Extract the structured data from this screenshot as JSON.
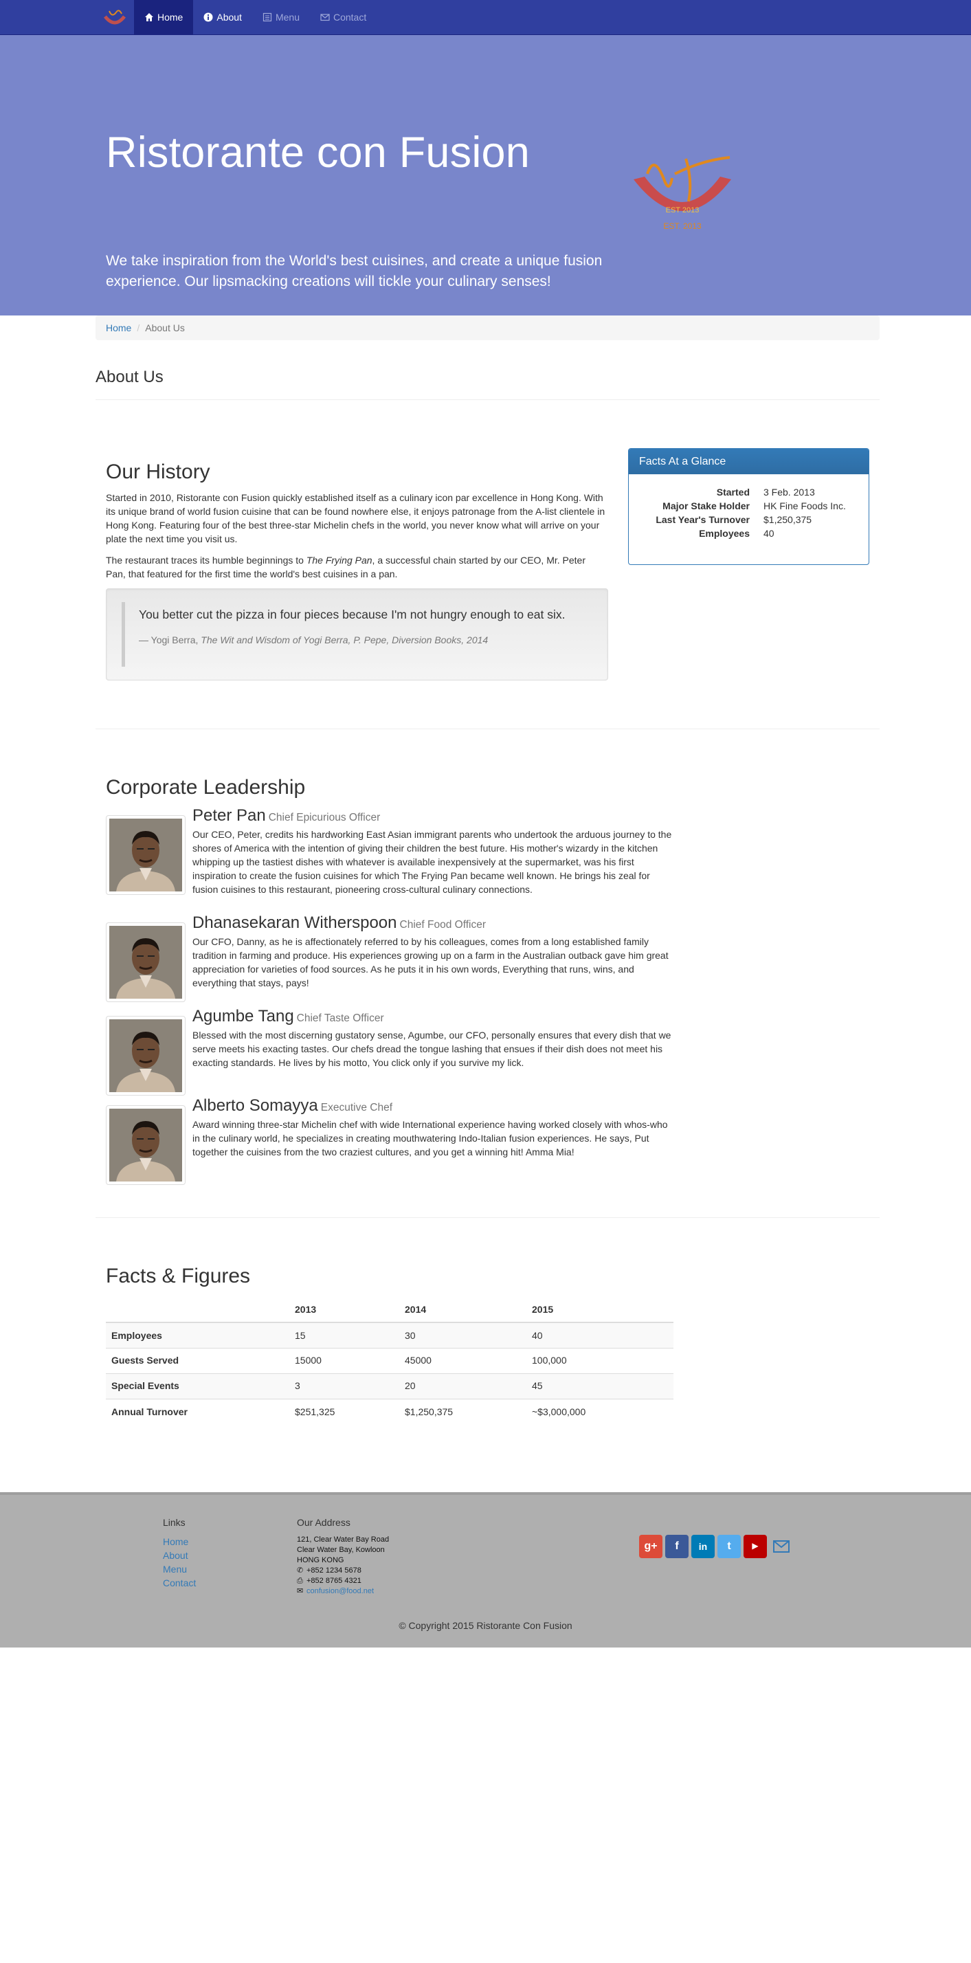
{
  "nav": {
    "brand_alt": "Ristorante con Fusion logo",
    "items": [
      {
        "label": "Home",
        "icon": "home-icon",
        "active": true
      },
      {
        "label": "About",
        "icon": "info-icon",
        "active": false
      },
      {
        "label": "Menu",
        "icon": "list-icon",
        "active": false
      },
      {
        "label": "Contact",
        "icon": "envelope-icon",
        "active": false
      }
    ]
  },
  "hero": {
    "title": "Ristorante con Fusion",
    "tagline": "We take inspiration from the World's best cuisines, and create a unique fusion experience. Our lipsmacking creations will tickle your culinary senses!"
  },
  "breadcrumb": {
    "home": "Home",
    "current": "About Us"
  },
  "page_title": "About Us",
  "history": {
    "heading": "Our History",
    "p1": "Started in 2010, Ristorante con Fusion quickly established itself as a culinary icon par excellence in Hong Kong. With its unique brand of world fusion cuisine that can be found nowhere else, it enjoys patronage from the A-list clientele in Hong Kong. Featuring four of the best three-star Michelin chefs in the world, you never know what will arrive on your plate the next time you visit us.",
    "p2_before": "The restaurant traces its humble beginnings to ",
    "p2_em": "The Frying Pan",
    "p2_after": ", a successful chain started by our CEO, Mr. Peter Pan, that featured for the first time the world's best cuisines in a pan.",
    "quote": "You better cut the pizza in four pieces because I'm not hungry enough to eat six.",
    "quote_author": "— Yogi Berra, ",
    "quote_source": "The Wit and Wisdom of Yogi Berra, P. Pepe, Diversion Books, 2014"
  },
  "facts": {
    "heading": "Facts At a Glance",
    "rows": [
      {
        "k": "Started",
        "v": "3 Feb. 2013"
      },
      {
        "k": "Major Stake Holder",
        "v": "HK Fine Foods Inc."
      },
      {
        "k": "Last Year's Turnover",
        "v": "$1,250,375"
      },
      {
        "k": "Employees",
        "v": "40"
      }
    ]
  },
  "leadership": {
    "heading": "Corporate Leadership",
    "leaders": [
      {
        "name": "Peter Pan",
        "title": "Chief Epicurious Officer",
        "desc": "Our CEO, Peter, credits his hardworking East Asian immigrant parents who undertook the arduous journey to the shores of America with the intention of giving their children the best future. His mother's wizardy in the kitchen whipping up the tastiest dishes with whatever is available inexpensively at the supermarket, was his first inspiration to create the fusion cuisines for which The Frying Pan became well known. He brings his zeal for fusion cuisines to this restaurant, pioneering cross-cultural culinary connections."
      },
      {
        "name": "Dhanasekaran Witherspoon",
        "title": "Chief Food Officer",
        "desc": "Our CFO, Danny, as he is affectionately referred to by his colleagues, comes from a long established family tradition in farming and produce. His experiences growing up on a farm in the Australian outback gave him great appreciation for varieties of food sources. As he puts it in his own words, Everything that runs, wins, and everything that stays, pays!"
      },
      {
        "name": "Agumbe Tang",
        "title": "Chief Taste Officer",
        "desc": "Blessed with the most discerning gustatory sense, Agumbe, our CFO, personally ensures that every dish that we serve meets his exacting tastes. Our chefs dread the tongue lashing that ensues if their dish does not meet his exacting standards. He lives by his motto, You click only if you survive my lick."
      },
      {
        "name": "Alberto Somayya",
        "title": "Executive Chef",
        "desc": "Award winning three-star Michelin chef with wide International experience having worked closely with whos-who in the culinary world, he specializes in creating mouthwatering Indo-Italian fusion experiences. He says, Put together the cuisines from the two craziest cultures, and you get a winning hit! Amma Mia!"
      }
    ]
  },
  "figures": {
    "heading": "Facts & Figures",
    "columns": [
      "",
      "2013",
      "2014",
      "2015"
    ],
    "rows": [
      {
        "label": "Employees",
        "values": [
          "15",
          "30",
          "40"
        ]
      },
      {
        "label": "Guests Served",
        "values": [
          "15000",
          "45000",
          "100,000"
        ]
      },
      {
        "label": "Special Events",
        "values": [
          "3",
          "20",
          "45"
        ]
      },
      {
        "label": "Annual Turnover",
        "values": [
          "$251,325",
          "$1,250,375",
          "~$3,000,000"
        ]
      }
    ]
  },
  "footer": {
    "links_heading": "Links",
    "links": [
      "Home",
      "About",
      "Menu",
      "Contact"
    ],
    "address_heading": "Our Address",
    "address_lines": [
      "121, Clear Water Bay Road",
      "Clear Water Bay, Kowloon",
      "HONG KONG"
    ],
    "phone": "+852 1234 5678",
    "fax": "+852 8765 4321",
    "email": "confusion@food.net",
    "social": [
      {
        "name": "google-plus",
        "glyph": "g+",
        "color": "#dd4b39"
      },
      {
        "name": "facebook",
        "glyph": "f",
        "color": "#3b5998"
      },
      {
        "name": "linkedin",
        "glyph": "in",
        "color": "#007bb6"
      },
      {
        "name": "twitter",
        "glyph": "t",
        "color": "#55acee"
      },
      {
        "name": "youtube",
        "glyph": "▶",
        "color": "#bb0000"
      }
    ],
    "copyright": "© Copyright 2015 Ristorante Con Fusion"
  }
}
